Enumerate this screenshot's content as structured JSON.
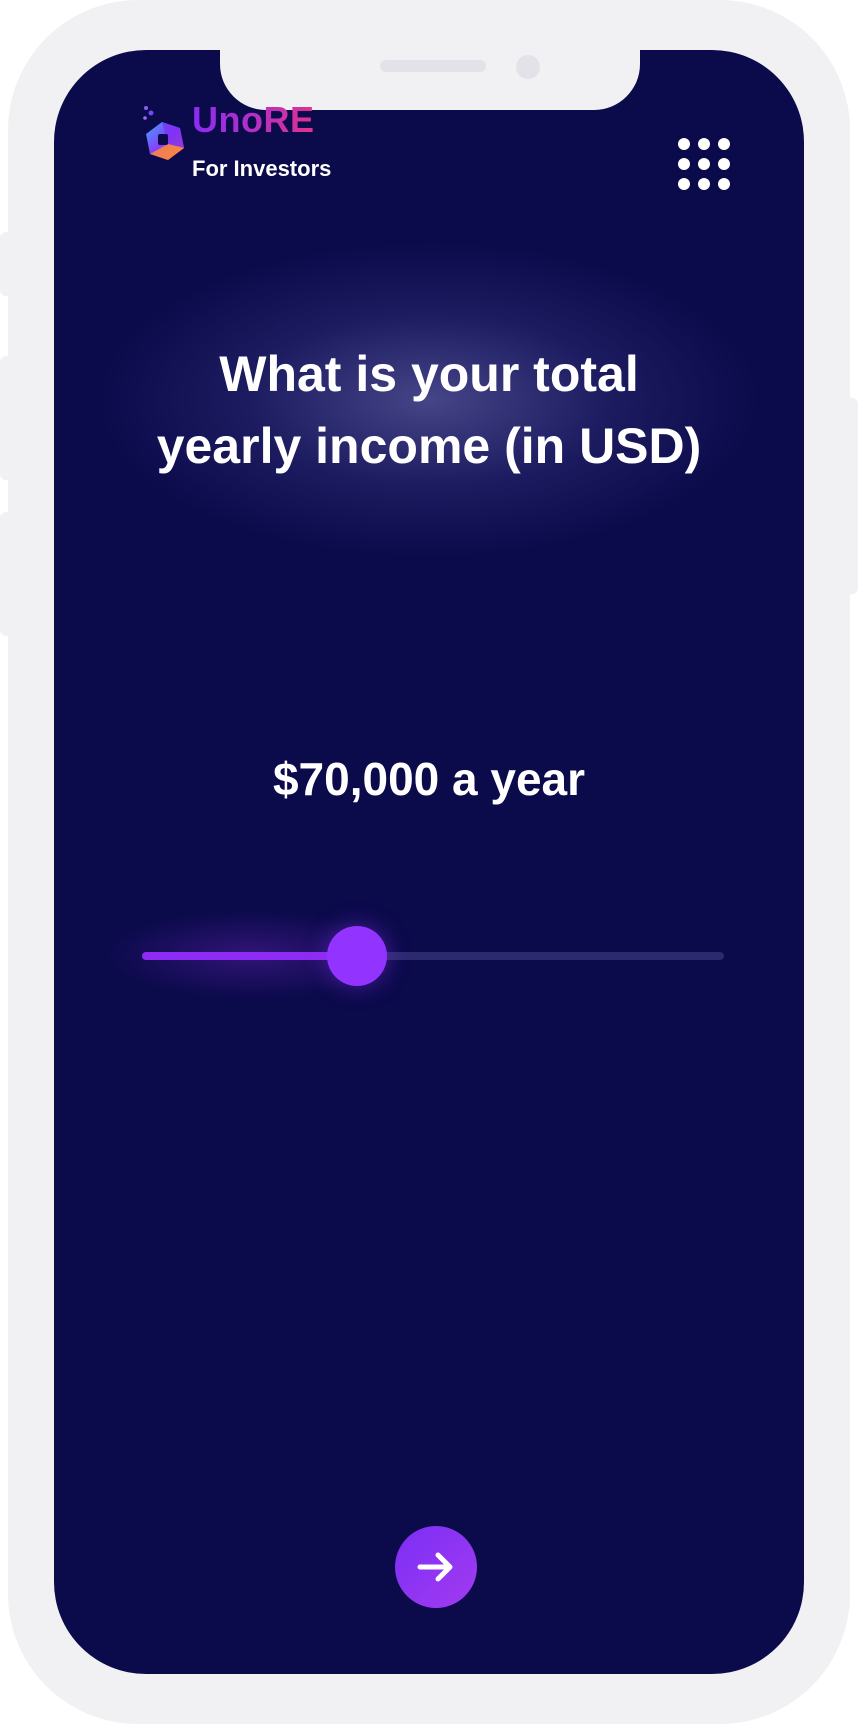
{
  "app": {
    "brand_name": "UnoRE",
    "brand_subtitle": "For Investors",
    "brand_gradient": [
      "#8a2cf6",
      "#e0338f"
    ],
    "menu_icon": "grid-menu-icon"
  },
  "question": {
    "line1": "What is your total",
    "line2": "yearly income (in USD)"
  },
  "income": {
    "label": "$70,000 a year",
    "slider_fraction": 0.37
  },
  "navigation": {
    "next_icon": "arrow-right-icon"
  },
  "colors": {
    "background": "#0b0a4b",
    "accent": "#8e2cf5",
    "track": "#2c2a6e",
    "frame": "#f1f1f4"
  }
}
